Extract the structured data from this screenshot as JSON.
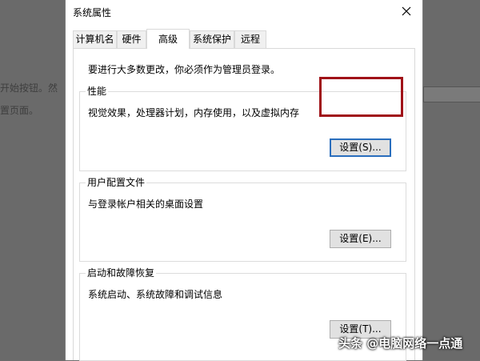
{
  "background": {
    "text_line_1": "开始按钮。然",
    "text_line_2": "置页面。"
  },
  "dialog": {
    "title": "系统属性",
    "close_icon": "close-icon",
    "tabs": [
      {
        "label": "计算机名",
        "active": false
      },
      {
        "label": "硬件",
        "active": false
      },
      {
        "label": "高级",
        "active": true
      },
      {
        "label": "系统保护",
        "active": false
      },
      {
        "label": "远程",
        "active": false
      }
    ],
    "admin_note": "要进行大多数更改，你必须作为管理员登录。",
    "performance": {
      "label": "性能",
      "description": "视觉效果，处理器计划，内存使用，以及虚拟内存",
      "button": "设置(S)..."
    },
    "user_profiles": {
      "label": "用户配置文件",
      "description": "与登录帐户相关的桌面设置",
      "button": "设置(E)..."
    },
    "startup_recovery": {
      "label": "启动和故障恢复",
      "description": "系统启动、系统故障和调试信息",
      "button": "设置(T)..."
    }
  },
  "highlight_color": "#a01218",
  "watermark": "头条 @电脑网络一点通"
}
